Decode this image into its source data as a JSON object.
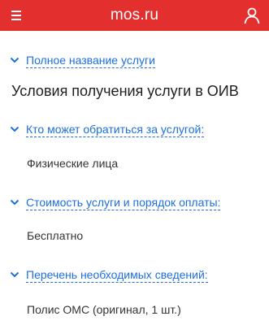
{
  "header": {
    "title": "mos.ru",
    "background": "#e42f2f",
    "menu_icon": "hamburger-menu-icon",
    "user_icon": "user-icon"
  },
  "peek_text": "...",
  "sections": {
    "full_name_link": "Полное название услуги",
    "conditions_heading": "Условия получения услуги в ОИВ",
    "who_link": "Кто может обратиться за услугой:",
    "who_value": "Физические лица",
    "cost_link": "Стоимость услуги и порядок оплаты:",
    "cost_value": "Бесплатно",
    "docs_link": "Перечень необходимых сведений:",
    "docs_value": "Полис ОМС (оригинал, 1 шт.)"
  },
  "colors": {
    "link": "#1d6fe0",
    "text": "#333333"
  }
}
